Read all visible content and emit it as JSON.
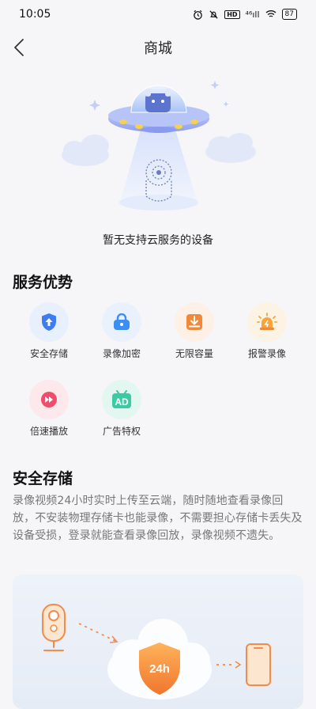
{
  "status_bar": {
    "time": "10:05",
    "network": "⁴⁶ıll",
    "battery": "87"
  },
  "header": {
    "title": "商城"
  },
  "empty_state": {
    "message": "暂无支持云服务的设备"
  },
  "advantages": {
    "title": "服务优势",
    "items": [
      {
        "label": "安全存储",
        "icon": "shield-upload-icon",
        "color": "#3d7cf3",
        "bg": "#e9f0fd"
      },
      {
        "label": "录像加密",
        "icon": "lock-icon",
        "color": "#3d8ef3",
        "bg": "#e9f1fd"
      },
      {
        "label": "无限容量",
        "icon": "download-icon",
        "color": "#f08a3a",
        "bg": "#fdf0e6"
      },
      {
        "label": "报警录像",
        "icon": "alarm-icon",
        "color": "#f5a63b",
        "bg": "#fdf3e4"
      },
      {
        "label": "倍速播放",
        "icon": "fast-forward-icon",
        "color": "#ee4d6b",
        "bg": "#fde8ec"
      },
      {
        "label": "广告特权",
        "icon": "ad-icon",
        "color": "#3cc9a4",
        "bg": "#e3f7f1"
      }
    ]
  },
  "secure_storage": {
    "title": "安全存储",
    "description": "录像视频24小时实时上传至云端，随时随地查看录像回放，不安装物理存储卡也能录像，不需要担心存储卡丢失及设备受损，登录就能查看录像回放，录像视频不遗失。",
    "badge": "24h"
  }
}
